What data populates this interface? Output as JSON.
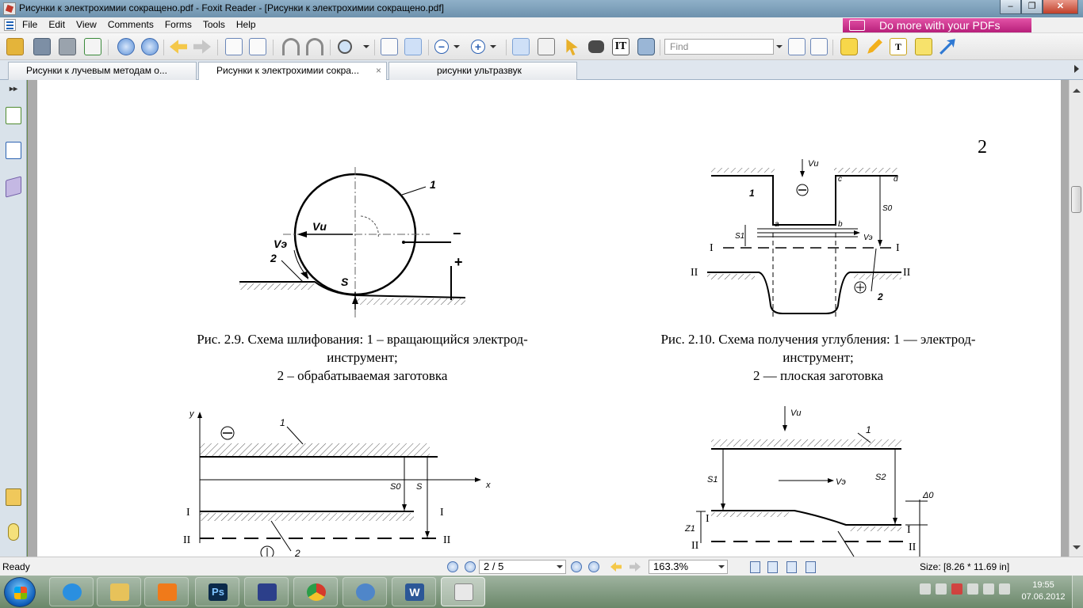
{
  "window": {
    "title": "Рисунки к электрохимии сокращено.pdf - Foxit Reader - [Рисунки к электрохимии сокращено.pdf]",
    "minimize_glyph": "–",
    "restore_glyph": "❐",
    "close_glyph": "✕"
  },
  "menu": {
    "items": [
      "File",
      "Edit",
      "View",
      "Comments",
      "Forms",
      "Tools",
      "Help"
    ]
  },
  "promo": {
    "label": "Do more with your PDFs"
  },
  "toolbar": {
    "find_placeholder": "Find",
    "zoom_out_glyph": "−",
    "zoom_in_glyph": "+",
    "text_glyph": "IT",
    "textbox_glyph": "T"
  },
  "tabs": [
    {
      "label": "Рисунки к лучевым методам о..."
    },
    {
      "label": "Рисунки к электрохимии сокра...",
      "close": "×"
    },
    {
      "label": "рисунки ультразвук"
    }
  ],
  "left_panel": {
    "expand_glyph": "▸▸"
  },
  "document": {
    "page_number": "2",
    "fig29": {
      "caption_line1": "Рис. 2.9. Схема шлифования: 1 – вращающийся электрод-",
      "caption_line2": "инструмент;",
      "caption_line3": "2 – обрабатываемая заготовка",
      "labels": {
        "one": "1",
        "two": "2",
        "vu": "Vи",
        "ve": "Vэ",
        "s": "S",
        "minus": "−",
        "plus": "+"
      }
    },
    "fig210": {
      "caption_line1": "Рис. 2.10. Схема получения углубления: 1 — электрод-",
      "caption_line2": "инструмент;",
      "caption_line3": "2 — плоская заготовка",
      "labels": {
        "vu": "Vи",
        "one": "1",
        "two": "2",
        "a": "a",
        "b": "b",
        "c": "c",
        "d": "d",
        "s1": "S1",
        "s0": "S0",
        "ve": "Vэ",
        "roman1": "I",
        "roman2": "II",
        "minus": "⊖",
        "plus": "⊕"
      }
    },
    "fig_bottom_left": {
      "labels": {
        "y": "y",
        "x": "x",
        "one": "1",
        "two": "2",
        "s0": "S0",
        "s": "S",
        "roman1": "I",
        "roman2": "II",
        "minus": "⊖",
        "plus": "⊕"
      }
    },
    "fig_bottom_right": {
      "labels": {
        "vu": "Vи",
        "one": "1",
        "s1": "S1",
        "s2": "S2",
        "ve": "Vэ",
        "z1": "Z1",
        "delta0": "Δ0",
        "roman1": "I",
        "roman2": "II"
      }
    }
  },
  "status": {
    "ready": "Ready",
    "page": "2 / 5",
    "zoom": "163.3%",
    "size": "Size: [8.26 * 11.69 in]"
  },
  "taskbar": {
    "time": "19:55",
    "date": "07.06.2012",
    "apps": [
      {
        "name": "internet-explorer",
        "color": "#2a8fe0"
      },
      {
        "name": "file-explorer",
        "color": "#e7c25a"
      },
      {
        "name": "media-player",
        "color": "#f07a1a"
      },
      {
        "name": "photoshop",
        "color": "#0b2a4a",
        "label": "Ps"
      },
      {
        "name": "save-disk",
        "color": "#2c3f8a"
      },
      {
        "name": "chrome",
        "color": "#d53a2c"
      },
      {
        "name": "blue-app",
        "color": "#4f86c9"
      },
      {
        "name": "word",
        "color": "#2b5797",
        "label": "W"
      },
      {
        "name": "foxit-reader",
        "color": "#e8e8e8"
      }
    ]
  }
}
